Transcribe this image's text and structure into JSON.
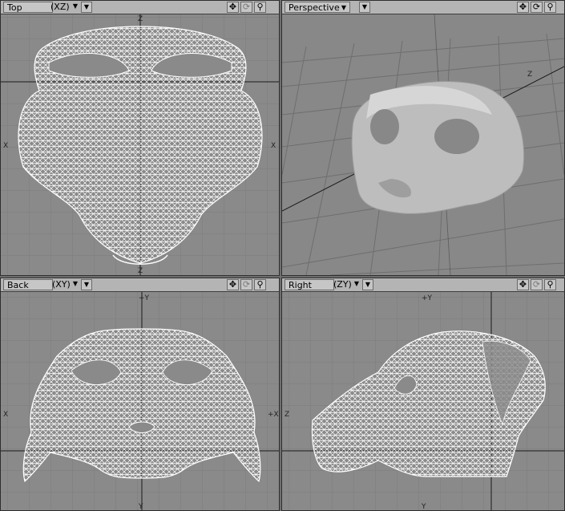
{
  "viewports": {
    "top": {
      "mode_label": "Top",
      "axes_label": "(XZ)",
      "axis_top": "Z",
      "axis_bottom": "Z",
      "axis_left": "X",
      "axis_right": "X"
    },
    "perspective": {
      "mode_label": "Perspective",
      "axes_label": "",
      "axis_top": "Z"
    },
    "back": {
      "mode_label": "Back",
      "axes_label": "(XY)",
      "axis_top": "+Y",
      "axis_bottom": "Y",
      "axis_left": "X",
      "axis_right": "+X"
    },
    "right": {
      "mode_label": "Right",
      "axes_label": "(ZY)",
      "axis_top": "+Y",
      "axis_bottom": "Y",
      "axis_left": "Z"
    }
  },
  "icons": {
    "move": "move-icon",
    "rotate": "rotate-icon",
    "zoom": "magnifier-icon",
    "dropdown": "chevron-down-icon"
  },
  "colors": {
    "viewport_bg": "#8a8a8a",
    "grid": "#7a7a7a",
    "axis": "#1a1a1a",
    "wireframe": "#ffffff",
    "header": "#b4b4b4"
  }
}
